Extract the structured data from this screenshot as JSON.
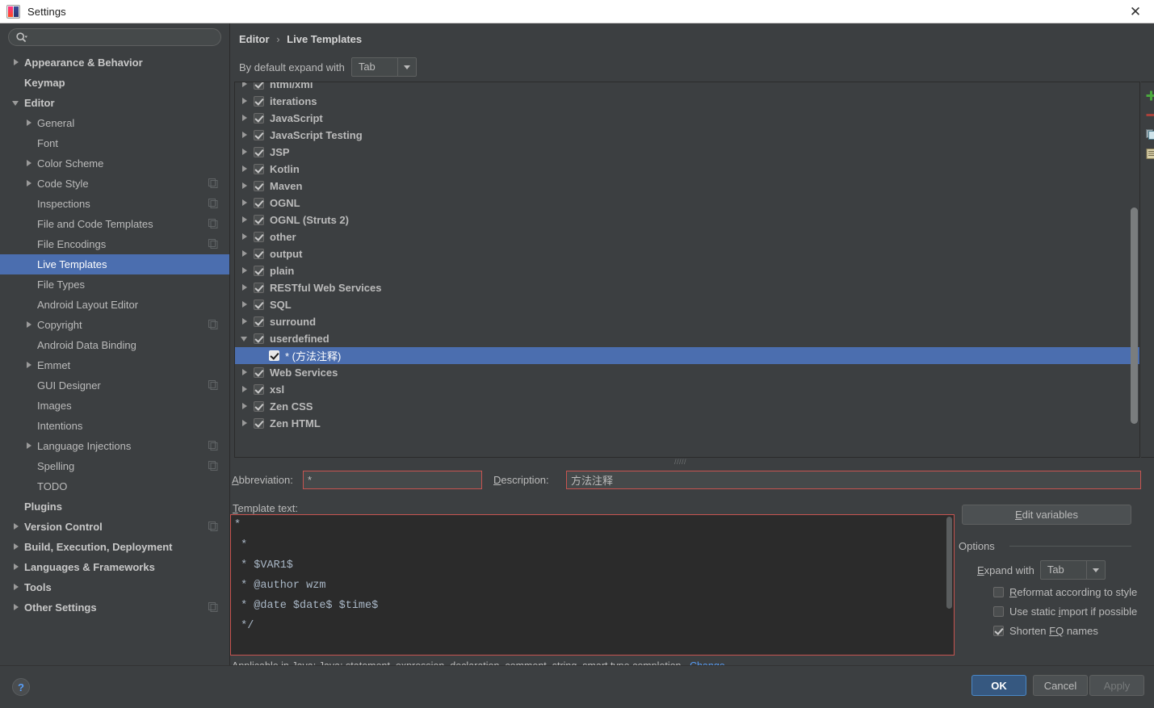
{
  "window": {
    "title": "Settings",
    "close_label": "✕",
    "app_icon": "intellij-idea-icon"
  },
  "sidebar": {
    "search": {
      "placeholder": "",
      "value": "",
      "icon": "search-icon"
    },
    "items": [
      {
        "label": "Appearance & Behavior",
        "indent": 0,
        "twisty": "collapsed",
        "bold": true,
        "sync": false,
        "selected": false
      },
      {
        "label": "Keymap",
        "indent": 0,
        "twisty": "none",
        "bold": true,
        "sync": false,
        "selected": false
      },
      {
        "label": "Editor",
        "indent": 0,
        "twisty": "expanded",
        "bold": true,
        "sync": false,
        "selected": false
      },
      {
        "label": "General",
        "indent": 1,
        "twisty": "collapsed",
        "bold": false,
        "sync": false,
        "selected": false
      },
      {
        "label": "Font",
        "indent": 1,
        "twisty": "none",
        "bold": false,
        "sync": false,
        "selected": false
      },
      {
        "label": "Color Scheme",
        "indent": 1,
        "twisty": "collapsed",
        "bold": false,
        "sync": false,
        "selected": false
      },
      {
        "label": "Code Style",
        "indent": 1,
        "twisty": "collapsed",
        "bold": false,
        "sync": true,
        "selected": false
      },
      {
        "label": "Inspections",
        "indent": 1,
        "twisty": "none",
        "bold": false,
        "sync": true,
        "selected": false
      },
      {
        "label": "File and Code Templates",
        "indent": 1,
        "twisty": "none",
        "bold": false,
        "sync": true,
        "selected": false
      },
      {
        "label": "File Encodings",
        "indent": 1,
        "twisty": "none",
        "bold": false,
        "sync": true,
        "selected": false
      },
      {
        "label": "Live Templates",
        "indent": 1,
        "twisty": "none",
        "bold": false,
        "sync": false,
        "selected": true
      },
      {
        "label": "File Types",
        "indent": 1,
        "twisty": "none",
        "bold": false,
        "sync": false,
        "selected": false
      },
      {
        "label": "Android Layout Editor",
        "indent": 1,
        "twisty": "none",
        "bold": false,
        "sync": false,
        "selected": false
      },
      {
        "label": "Copyright",
        "indent": 1,
        "twisty": "collapsed",
        "bold": false,
        "sync": true,
        "selected": false
      },
      {
        "label": "Android Data Binding",
        "indent": 1,
        "twisty": "none",
        "bold": false,
        "sync": false,
        "selected": false
      },
      {
        "label": "Emmet",
        "indent": 1,
        "twisty": "collapsed",
        "bold": false,
        "sync": false,
        "selected": false
      },
      {
        "label": "GUI Designer",
        "indent": 1,
        "twisty": "none",
        "bold": false,
        "sync": true,
        "selected": false
      },
      {
        "label": "Images",
        "indent": 1,
        "twisty": "none",
        "bold": false,
        "sync": false,
        "selected": false
      },
      {
        "label": "Intentions",
        "indent": 1,
        "twisty": "none",
        "bold": false,
        "sync": false,
        "selected": false
      },
      {
        "label": "Language Injections",
        "indent": 1,
        "twisty": "collapsed",
        "bold": false,
        "sync": true,
        "selected": false
      },
      {
        "label": "Spelling",
        "indent": 1,
        "twisty": "none",
        "bold": false,
        "sync": true,
        "selected": false
      },
      {
        "label": "TODO",
        "indent": 1,
        "twisty": "none",
        "bold": false,
        "sync": false,
        "selected": false
      },
      {
        "label": "Plugins",
        "indent": 0,
        "twisty": "none",
        "bold": true,
        "sync": false,
        "selected": false
      },
      {
        "label": "Version Control",
        "indent": 0,
        "twisty": "collapsed",
        "bold": true,
        "sync": true,
        "selected": false
      },
      {
        "label": "Build, Execution, Deployment",
        "indent": 0,
        "twisty": "collapsed",
        "bold": true,
        "sync": false,
        "selected": false
      },
      {
        "label": "Languages & Frameworks",
        "indent": 0,
        "twisty": "collapsed",
        "bold": true,
        "sync": false,
        "selected": false
      },
      {
        "label": "Tools",
        "indent": 0,
        "twisty": "collapsed",
        "bold": true,
        "sync": false,
        "selected": false
      },
      {
        "label": "Other Settings",
        "indent": 0,
        "twisty": "collapsed",
        "bold": true,
        "sync": true,
        "selected": false
      }
    ]
  },
  "content": {
    "breadcrumb": {
      "root": "Editor",
      "separator": "›",
      "leaf": "Live Templates"
    },
    "expand_with": {
      "label": "By default expand with",
      "value": "Tab"
    },
    "list_tools": [
      {
        "name": "add-template-button",
        "icon": "plus-icon"
      },
      {
        "name": "remove-template-button",
        "icon": "minus-icon"
      },
      {
        "name": "duplicate-template-button",
        "icon": "copy-icon"
      },
      {
        "name": "restore-defaults-button",
        "icon": "document-icon"
      }
    ],
    "templates": [
      {
        "label": "html/xml",
        "twisty": "collapsed",
        "checked": true,
        "child": false,
        "selected": false,
        "clipped": true
      },
      {
        "label": "iterations",
        "twisty": "collapsed",
        "checked": true,
        "child": false,
        "selected": false
      },
      {
        "label": "JavaScript",
        "twisty": "collapsed",
        "checked": true,
        "child": false,
        "selected": false
      },
      {
        "label": "JavaScript Testing",
        "twisty": "collapsed",
        "checked": true,
        "child": false,
        "selected": false
      },
      {
        "label": "JSP",
        "twisty": "collapsed",
        "checked": true,
        "child": false,
        "selected": false
      },
      {
        "label": "Kotlin",
        "twisty": "collapsed",
        "checked": true,
        "child": false,
        "selected": false
      },
      {
        "label": "Maven",
        "twisty": "collapsed",
        "checked": true,
        "child": false,
        "selected": false
      },
      {
        "label": "OGNL",
        "twisty": "collapsed",
        "checked": true,
        "child": false,
        "selected": false
      },
      {
        "label": "OGNL (Struts 2)",
        "twisty": "collapsed",
        "checked": true,
        "child": false,
        "selected": false
      },
      {
        "label": "other",
        "twisty": "collapsed",
        "checked": true,
        "child": false,
        "selected": false
      },
      {
        "label": "output",
        "twisty": "collapsed",
        "checked": true,
        "child": false,
        "selected": false
      },
      {
        "label": "plain",
        "twisty": "collapsed",
        "checked": true,
        "child": false,
        "selected": false
      },
      {
        "label": "RESTful Web Services",
        "twisty": "collapsed",
        "checked": true,
        "child": false,
        "selected": false
      },
      {
        "label": "SQL",
        "twisty": "collapsed",
        "checked": true,
        "child": false,
        "selected": false
      },
      {
        "label": "surround",
        "twisty": "collapsed",
        "checked": true,
        "child": false,
        "selected": false
      },
      {
        "label": "userdefined",
        "twisty": "expanded",
        "checked": true,
        "child": false,
        "selected": false
      },
      {
        "label": "* (方法注释)",
        "twisty": "none",
        "checked": true,
        "child": true,
        "selected": true
      },
      {
        "label": "Web Services",
        "twisty": "collapsed",
        "checked": true,
        "child": false,
        "selected": false
      },
      {
        "label": "xsl",
        "twisty": "collapsed",
        "checked": true,
        "child": false,
        "selected": false
      },
      {
        "label": "Zen CSS",
        "twisty": "collapsed",
        "checked": true,
        "child": false,
        "selected": false
      },
      {
        "label": "Zen HTML",
        "twisty": "collapsed",
        "checked": true,
        "child": false,
        "selected": false
      }
    ],
    "abbreviation": {
      "label": "Abbreviation:",
      "value": "*"
    },
    "description": {
      "label": "Description:",
      "value": "方法注释"
    },
    "template_text": {
      "label": "Template text:",
      "lines": [
        "*",
        " *",
        " * $VAR1$",
        " * @author wzm",
        " * @date $date$ $time$",
        " */"
      ]
    },
    "applicable": {
      "text": "Applicable in Java; Java: statement, expression, declaration, comment, string, smart type completion...",
      "change_label": "Change"
    },
    "options": {
      "edit_variables_label": "Edit variables",
      "title": "Options",
      "expand_with": {
        "label": "Expand with",
        "value": "Tab"
      },
      "checkboxes": [
        {
          "label": "Reformat according to style",
          "checked": false
        },
        {
          "label": "Use static import if possible",
          "checked": false
        },
        {
          "label": "Shorten FQ names",
          "checked": true
        }
      ]
    }
  },
  "footer": {
    "help_label": "?",
    "ok_label": "OK",
    "cancel_label": "Cancel",
    "apply_label": "Apply"
  },
  "colors": {
    "accent_selection": "#4b6eaf",
    "primary_button": "#365880",
    "error_border": "#c75450",
    "link": "#589df6",
    "background": "#3c3f41",
    "editor_background": "#2b2b2b"
  }
}
